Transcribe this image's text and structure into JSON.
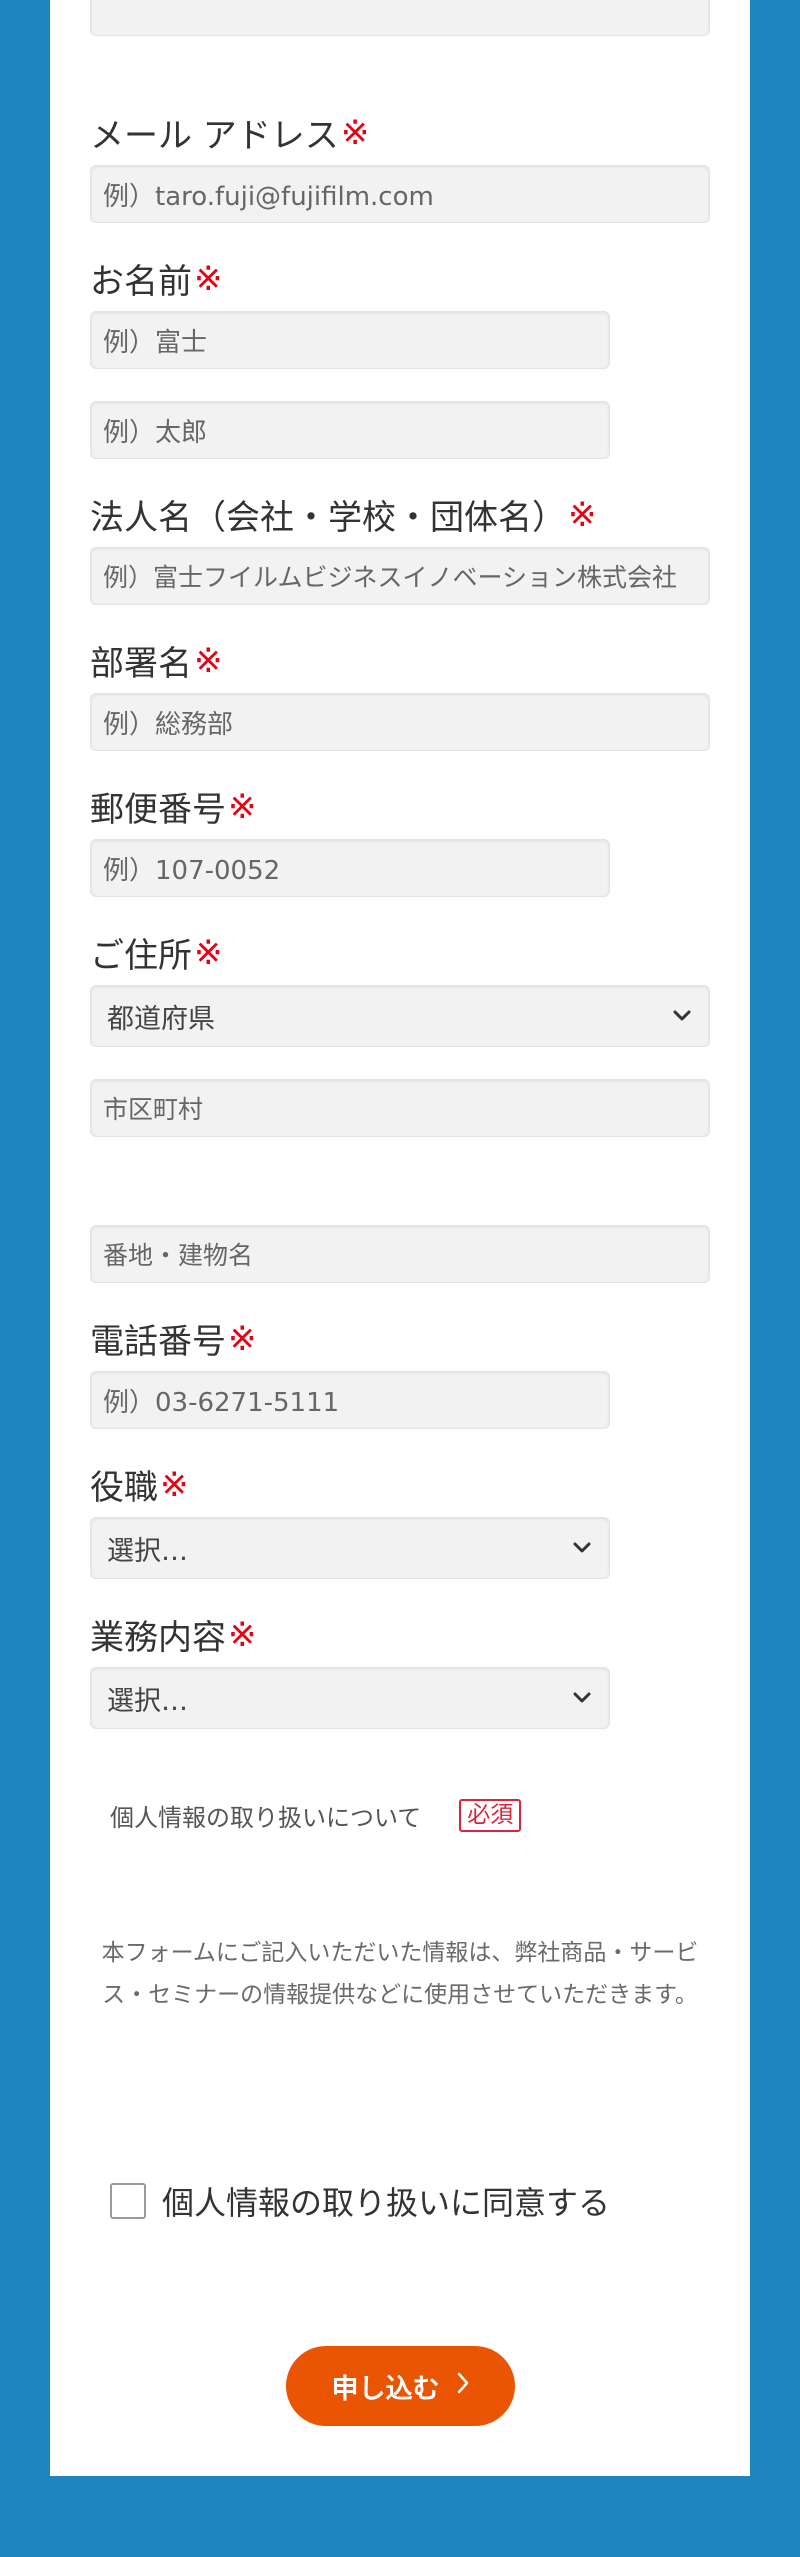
{
  "colors": {
    "background": "#1e84c0",
    "panel": "#ffffff",
    "required_mark": "#e60012",
    "submit_button": "#ea5504"
  },
  "required_mark": "※",
  "email": {
    "label": "メール アドレス",
    "placeholder": "例）taro.fuji@fujifilm.com"
  },
  "name": {
    "label": "お名前",
    "last_placeholder": "例）富士",
    "first_placeholder": "例）太郎"
  },
  "company": {
    "label": "法人名（会社・学校・団体名）",
    "placeholder": "例）富士フイルムビジネスイノベーション株式会社"
  },
  "department": {
    "label": "部署名",
    "placeholder": "例）総務部"
  },
  "postal": {
    "label": "郵便番号",
    "placeholder": "例）107-0052"
  },
  "address": {
    "label": "ご住所",
    "prefecture_selected": "都道府県",
    "city_placeholder": "市区町村",
    "street_placeholder": "番地・建物名"
  },
  "phone": {
    "label": "電話番号",
    "placeholder": "例）03-6271-5111"
  },
  "position": {
    "label": "役職",
    "selected": "選択…"
  },
  "business": {
    "label": "業務内容",
    "selected": "選択…"
  },
  "privacy": {
    "title": "個人情報の取り扱いについて",
    "badge": "必須",
    "notice": "本フォームにご記入いただいた情報は、弊社商品・サービス・セミナーの情報提供などに使用させていただきます。",
    "consent_label": "個人情報の取り扱いに同意する"
  },
  "submit": {
    "label": "申し込む",
    "icon": "chevron-right-icon"
  },
  "icons": {
    "select_arrow": "chevron-down-icon"
  }
}
